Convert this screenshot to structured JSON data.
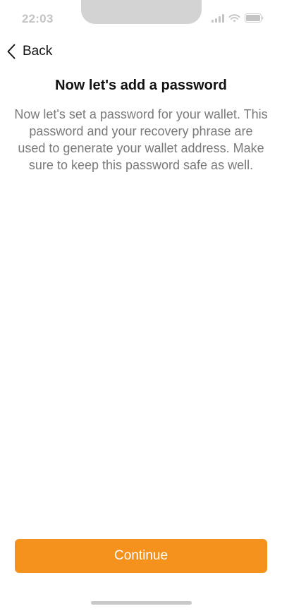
{
  "status_bar": {
    "time": "22:03",
    "icons": [
      "signal-icon",
      "wifi-icon",
      "battery-icon"
    ]
  },
  "nav": {
    "back_label": "Back",
    "back_icon": "chevron-left-icon"
  },
  "main": {
    "title": "Now let's add a password",
    "description": "Now let's set a password for your wallet. This password and your recovery phrase are used to generate your wallet address. Make sure to keep this password safe as well."
  },
  "actions": {
    "continue_label": "Continue"
  },
  "colors": {
    "accent": "#f5921e",
    "text_secondary": "#7a7a7a",
    "status_gray": "#c4c4c4"
  }
}
